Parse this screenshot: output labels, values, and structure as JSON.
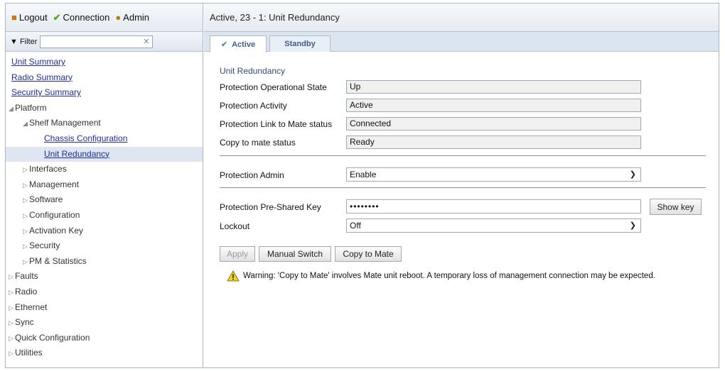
{
  "topbar": {
    "logout_label": "Logout",
    "connection_label": "Connection",
    "admin_label": "Admin"
  },
  "filter": {
    "label": "Filter",
    "value": "",
    "clear_glyph": "✕"
  },
  "tree": [
    {
      "label": "Unit Summary",
      "indent": 8,
      "link": true,
      "selected": false
    },
    {
      "label": "Radio Summary",
      "indent": 8,
      "link": true,
      "selected": false
    },
    {
      "label": "Security Summary",
      "indent": 8,
      "link": true,
      "selected": false
    },
    {
      "label": "Platform",
      "indent": 4,
      "arrow": "◢",
      "link": false,
      "selected": false
    },
    {
      "label": "Shelf Management",
      "indent": 24,
      "arrow": "◢",
      "link": false,
      "selected": false
    },
    {
      "label": "Chassis Configuration",
      "indent": 54,
      "link": true,
      "selected": false
    },
    {
      "label": "Unit Redundancy",
      "indent": 54,
      "link": true,
      "selected": true
    },
    {
      "label": "Interfaces",
      "indent": 24,
      "arrow": "▷",
      "link": false,
      "selected": false
    },
    {
      "label": "Management",
      "indent": 24,
      "arrow": "▷",
      "link": false,
      "selected": false
    },
    {
      "label": "Software",
      "indent": 24,
      "arrow": "▷",
      "link": false,
      "selected": false
    },
    {
      "label": "Configuration",
      "indent": 24,
      "arrow": "▷",
      "link": false,
      "selected": false
    },
    {
      "label": "Activation Key",
      "indent": 24,
      "arrow": "▷",
      "link": false,
      "selected": false
    },
    {
      "label": "Security",
      "indent": 24,
      "arrow": "▷",
      "link": false,
      "selected": false
    },
    {
      "label": "PM & Statistics",
      "indent": 24,
      "arrow": "▷",
      "link": false,
      "selected": false
    },
    {
      "label": "Faults",
      "indent": 4,
      "arrow": "▷",
      "link": false,
      "selected": false
    },
    {
      "label": "Radio",
      "indent": 4,
      "arrow": "▷",
      "link": false,
      "selected": false
    },
    {
      "label": "Ethernet",
      "indent": 4,
      "arrow": "▷",
      "link": false,
      "selected": false
    },
    {
      "label": "Sync",
      "indent": 4,
      "arrow": "▷",
      "link": false,
      "selected": false
    },
    {
      "label": "Quick Configuration",
      "indent": 4,
      "arrow": "▷",
      "link": false,
      "selected": false
    },
    {
      "label": "Utilities",
      "indent": 4,
      "arrow": "▷",
      "link": false,
      "selected": false
    }
  ],
  "main": {
    "title": "Active, 23 - 1: Unit Redundancy",
    "tabs": {
      "active": "Active",
      "standby": "Standby"
    },
    "section_title": "Unit Redundancy",
    "fields": {
      "op_state": {
        "label": "Protection Operational State",
        "value": "Up"
      },
      "activity": {
        "label": "Protection Activity",
        "value": "Active"
      },
      "link_status": {
        "label": "Protection Link to Mate status",
        "value": "Connected"
      },
      "copy_status": {
        "label": "Copy to mate status",
        "value": "Ready"
      },
      "admin": {
        "label": "Protection Admin",
        "value": "Enable"
      },
      "psk": {
        "label": "Protection Pre-Shared Key",
        "value": "••••••••"
      },
      "lockout": {
        "label": "Lockout",
        "value": "Off"
      }
    },
    "buttons": {
      "show_key": "Show key",
      "apply": "Apply",
      "manual_switch": "Manual Switch",
      "copy_to_mate": "Copy to Mate"
    },
    "warning": "Warning: 'Copy to Mate' involves Mate unit reboot. A temporary loss of management connection may be expected."
  },
  "colors": {
    "accent": "#2e4c77",
    "link": "#1f2e9a",
    "selected_row": "#dde6f1",
    "warning_icon": "#f2d21a"
  }
}
